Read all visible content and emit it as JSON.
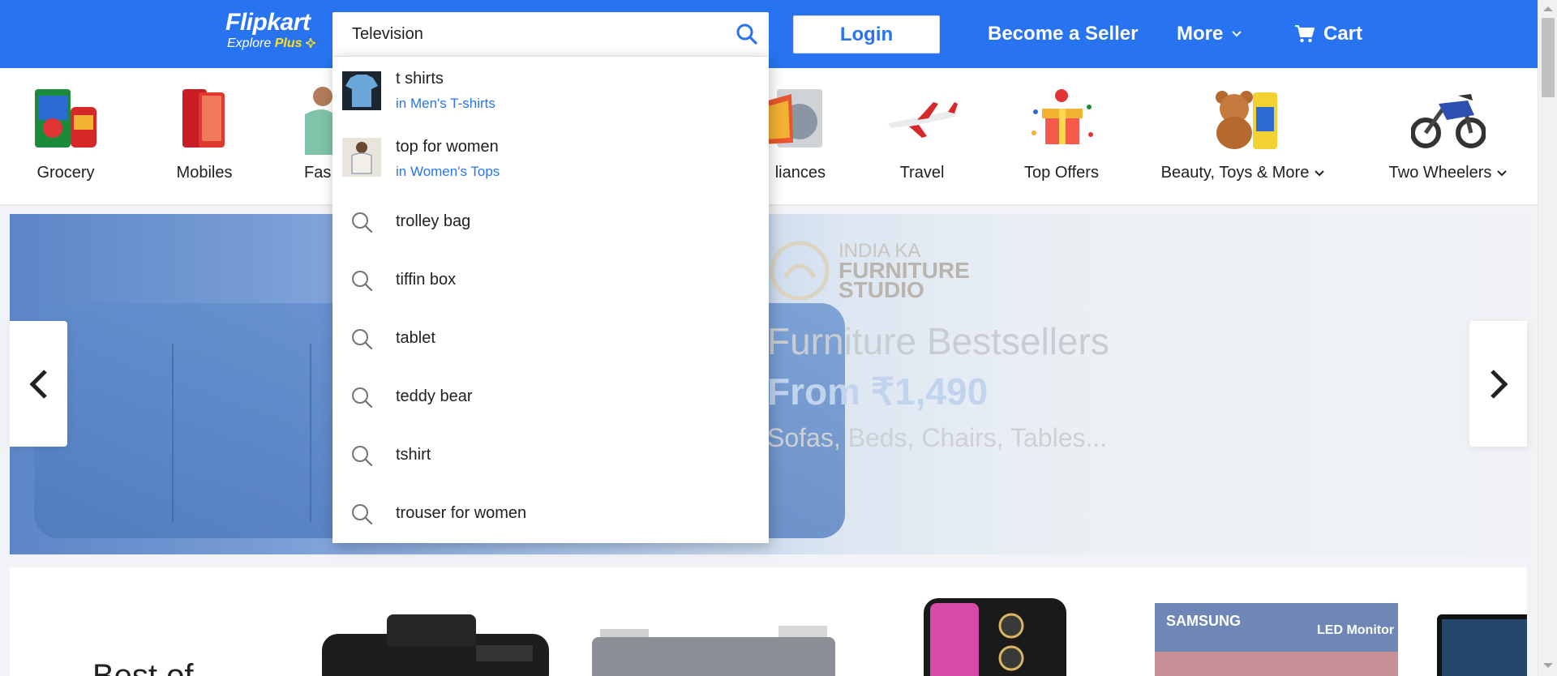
{
  "header": {
    "logo_name": "Flipkart",
    "logo_tag_prefix": "Explore ",
    "logo_tag_plus": "Plus",
    "search_value": "Television",
    "login_label": "Login",
    "seller_label": "Become a Seller",
    "more_label": "More",
    "cart_label": "Cart"
  },
  "categories": [
    {
      "label": "Grocery"
    },
    {
      "label": "Mobiles"
    },
    {
      "label": "Fas"
    },
    {
      "label": "liances"
    },
    {
      "label": "Travel"
    },
    {
      "label": "Top Offers"
    },
    {
      "label": "Beauty, Toys & More"
    },
    {
      "label": "Two Wheelers"
    }
  ],
  "banner": {
    "logo_line1": "INDIA KA",
    "logo_line2": "FURNITURE",
    "logo_line3": "STUDIO",
    "title": "Furniture Bestsellers",
    "price": "From ₹1,490",
    "subtitle": "Sofas, Beds, Chairs, Tables..."
  },
  "bestof": {
    "title": "Best of"
  },
  "suggestions": [
    {
      "text": "t shirts",
      "sub": "in Men's T-shirts",
      "kind": "thumb"
    },
    {
      "text": "top for women",
      "sub": "in Women's Tops",
      "kind": "thumb"
    },
    {
      "text": "trolley bag",
      "kind": "search-icon"
    },
    {
      "text": "tiffin box",
      "kind": "search-icon"
    },
    {
      "text": "tablet",
      "kind": "search-icon"
    },
    {
      "text": "teddy bear",
      "kind": "search-icon"
    },
    {
      "text": "tshirt",
      "kind": "search-icon"
    },
    {
      "text": "trouser for women",
      "kind": "search-icon"
    }
  ],
  "colors": {
    "brand": "#2874f0",
    "plus_yellow": "#ffe11b",
    "link_blue": "#2874f0"
  }
}
